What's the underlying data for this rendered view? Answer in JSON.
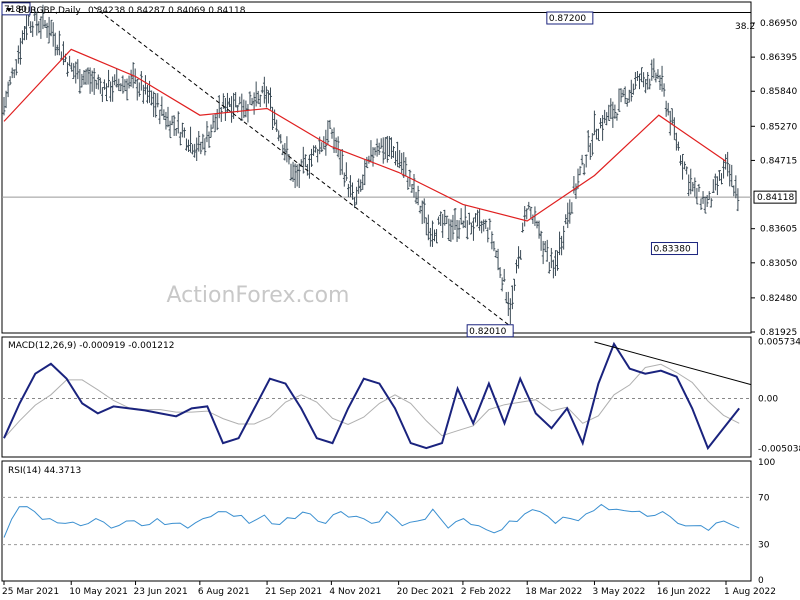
{
  "chart_data": [
    {
      "type": "ohlc",
      "title": "EURGBP,Daily",
      "ohlc_readout": "0.84238 0.84287 0.84069 0.84118",
      "ylim": [
        0.81925,
        0.87275
      ],
      "y_ticks": [
        "0.86950",
        "0.86395",
        "0.85840",
        "0.85270",
        "0.84715",
        "0.83605",
        "0.83050",
        "0.82480",
        "0.81925"
      ],
      "last_price": "0.84118",
      "ma_color": "#e02020",
      "bar_color": "#3a4a55",
      "annotations": [
        {
          "text": "7180",
          "x": "25 Mar 2021",
          "y": 0.8718
        },
        {
          "text": "0.87200",
          "x": "6 May 2022",
          "y": 0.872
        },
        {
          "text": "0.82010",
          "x": "7 Mar 2022",
          "y": 0.8201
        },
        {
          "text": "0.83380",
          "x": "7 Jul 2022",
          "y": 0.8338
        }
      ],
      "fib_level": "38.2",
      "fib_price": 0.8712,
      "trendline": {
        "from": {
          "x": "25 Mar 2021",
          "y": 0.8718
        },
        "to": {
          "x": "7 Mar 2022",
          "y": 0.8201
        }
      },
      "ma_points": [
        {
          "x": "25 Mar 2021",
          "y": 0.8535
        },
        {
          "x": "10 May 2021",
          "y": 0.8652
        },
        {
          "x": "23 Jun 2021",
          "y": 0.8608
        },
        {
          "x": "6 Aug 2021",
          "y": 0.8545
        },
        {
          "x": "21 Sep 2021",
          "y": 0.8556
        },
        {
          "x": "4 Nov 2021",
          "y": 0.8494
        },
        {
          "x": "20 Dec 2021",
          "y": 0.8452
        },
        {
          "x": "2 Feb 2022",
          "y": 0.84
        },
        {
          "x": "18 Mar 2022",
          "y": 0.8373
        },
        {
          "x": "3 May 2022",
          "y": 0.8447
        },
        {
          "x": "16 Jun 2022",
          "y": 0.8545
        },
        {
          "x": "1 Aug 2022",
          "y": 0.847
        }
      ],
      "price_points": [
        {
          "x": "25 Mar 2021",
          "y": 0.856
        },
        {
          "x": "10 Apr 2021",
          "y": 0.87
        },
        {
          "x": "25 Apr 2021",
          "y": 0.869
        },
        {
          "x": "10 May 2021",
          "y": 0.862
        },
        {
          "x": "1 Jun 2021",
          "y": 0.859
        },
        {
          "x": "23 Jun 2021",
          "y": 0.86
        },
        {
          "x": "15 Jul 2021",
          "y": 0.854
        },
        {
          "x": "6 Aug 2021",
          "y": 0.849
        },
        {
          "x": "25 Aug 2021",
          "y": 0.857
        },
        {
          "x": "10 Sep 2021",
          "y": 0.856
        },
        {
          "x": "21 Sep 2021",
          "y": 0.858
        },
        {
          "x": "10 Oct 2021",
          "y": 0.844
        },
        {
          "x": "4 Nov 2021",
          "y": 0.852
        },
        {
          "x": "20 Nov 2021",
          "y": 0.84
        },
        {
          "x": "5 Dec 2021",
          "y": 0.85
        },
        {
          "x": "20 Dec 2021",
          "y": 0.848
        },
        {
          "x": "10 Jan 2022",
          "y": 0.836
        },
        {
          "x": "2 Feb 2022",
          "y": 0.837
        },
        {
          "x": "20 Feb 2022",
          "y": 0.836
        },
        {
          "x": "7 Mar 2022",
          "y": 0.823
        },
        {
          "x": "18 Mar 2022",
          "y": 0.84
        },
        {
          "x": "5 Apr 2022",
          "y": 0.829
        },
        {
          "x": "15 Apr 2022",
          "y": 0.839
        },
        {
          "x": "3 May 2022",
          "y": 0.852
        },
        {
          "x": "20 May 2022",
          "y": 0.856
        },
        {
          "x": "1 Jun 2022",
          "y": 0.86
        },
        {
          "x": "16 Jun 2022",
          "y": 0.861
        },
        {
          "x": "1 Jul 2022",
          "y": 0.848
        },
        {
          "x": "10 Jul 2022",
          "y": 0.842
        },
        {
          "x": "20 Jul 2022",
          "y": 0.84
        },
        {
          "x": "1 Aug 2022",
          "y": 0.846
        },
        {
          "x": "10 Aug 2022",
          "y": 0.8412
        }
      ]
    },
    {
      "type": "line",
      "title": "MACD(12,26,9) -0.000919 -0.001212",
      "y_ticks": [
        "0.005734",
        "0.00",
        "-0.005038"
      ],
      "ylim": [
        -0.0058,
        0.0061
      ],
      "macd_color": "#1a237e",
      "signal_color": "#b0b0b0",
      "trendline": {
        "from": {
          "x": "3 May 2022",
          "y": 0.0057
        },
        "to": {
          "x": "16 Aug 2022",
          "y": 0.0014
        }
      },
      "series": [
        {
          "values": [
            -0.004,
            -0.0005,
            0.0025,
            0.0035,
            0.002,
            -0.0005,
            -0.0015,
            -0.0008,
            -0.001,
            -0.0012,
            -0.0015,
            -0.0018,
            -0.001,
            -0.0008,
            -0.0045,
            -0.004,
            -0.001,
            0.002,
            0.0015,
            -0.001,
            -0.004,
            -0.0045,
            -0.001,
            0.002,
            0.0015,
            -0.001,
            -0.0045,
            -0.005,
            -0.0045,
            0.001,
            -0.0025,
            0.0015,
            -0.0025,
            0.002,
            -0.0015,
            -0.003,
            -0.001,
            -0.0045,
            0.0015,
            0.0055,
            0.003,
            0.0025,
            0.0028,
            0.0022,
            -0.001,
            -0.005,
            -0.003,
            -0.001
          ]
        }
      ]
    },
    {
      "type": "line",
      "title": "RSI(14) 44.3713",
      "ylim": [
        0,
        100
      ],
      "y_ticks": [
        "100",
        "70",
        "30",
        "0"
      ],
      "rsi_color": "#3a8fd0",
      "series": [
        {
          "values": [
            36,
            62,
            58,
            52,
            48,
            46,
            52,
            44,
            50,
            46,
            52,
            48,
            44,
            52,
            58,
            54,
            48,
            55,
            47,
            52,
            56,
            48,
            58,
            54,
            48,
            58,
            46,
            50,
            60,
            44,
            52,
            46,
            40,
            50,
            56,
            58,
            48,
            52,
            56,
            64,
            60,
            58,
            54,
            58,
            48,
            46,
            42,
            50,
            44
          ]
        }
      ]
    }
  ],
  "x_ticks": [
    "25 Mar 2021",
    "10 May 2021",
    "23 Jun 2021",
    "6 Aug 2021",
    "21 Sep 2021",
    "4 Nov 2021",
    "20 Dec 2021",
    "2 Feb 2022",
    "18 Mar 2022",
    "3 May 2022",
    "16 Jun 2022",
    "1 Aug 2022"
  ],
  "watermark": "ActionForex.com"
}
